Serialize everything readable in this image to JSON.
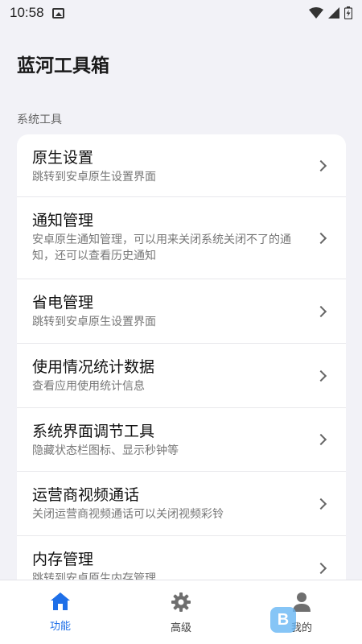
{
  "status_bar": {
    "time": "10:58"
  },
  "app": {
    "title": "蓝河工具箱"
  },
  "section": {
    "label": "系统工具"
  },
  "items": [
    {
      "title": "原生设置",
      "desc": "跳转到安卓原生设置界面"
    },
    {
      "title": "通知管理",
      "desc": "安卓原生通知管理，可以用来关闭系统关闭不了的通知，还可以查看历史通知"
    },
    {
      "title": "省电管理",
      "desc": "跳转到安卓原生设置界面"
    },
    {
      "title": "使用情况统计数据",
      "desc": "查看应用使用统计信息"
    },
    {
      "title": "系统界面调节工具",
      "desc": "隐藏状态栏图标、显示秒钟等"
    },
    {
      "title": "运营商视频通话",
      "desc": "关闭运营商视频通话可以关闭视频彩铃"
    },
    {
      "title": "内存管理",
      "desc": "跳转到安卓原生内存管理"
    }
  ],
  "tabs": [
    {
      "label": "功能",
      "icon": "home-icon",
      "active": true
    },
    {
      "label": "高级",
      "icon": "gear-icon",
      "active": false
    },
    {
      "label": "我的",
      "icon": "person-icon",
      "active": false
    }
  ],
  "colors": {
    "accent": "#1e6fe8",
    "background": "#f2f2f7"
  }
}
